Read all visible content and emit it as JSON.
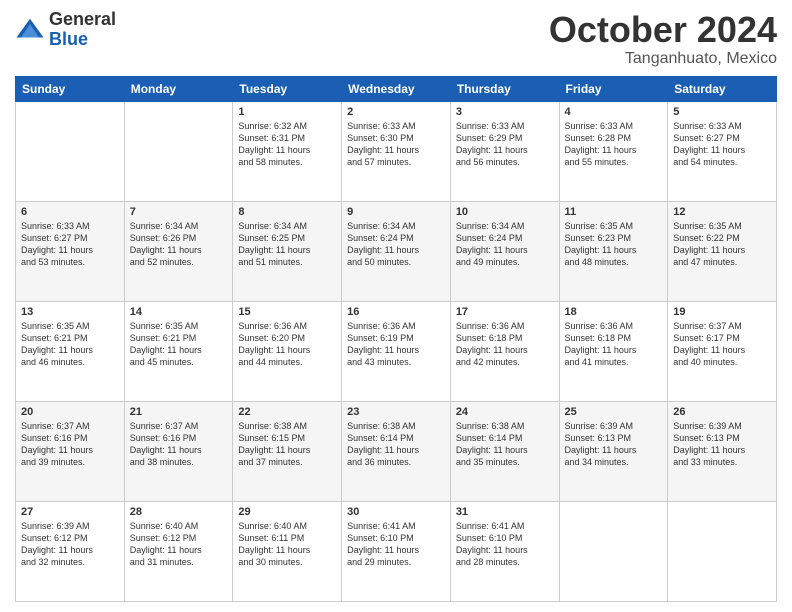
{
  "header": {
    "logo_general": "General",
    "logo_blue": "Blue",
    "month": "October 2024",
    "location": "Tanganhuato, Mexico"
  },
  "weekdays": [
    "Sunday",
    "Monday",
    "Tuesday",
    "Wednesday",
    "Thursday",
    "Friday",
    "Saturday"
  ],
  "weeks": [
    [
      {
        "day": "",
        "lines": []
      },
      {
        "day": "",
        "lines": []
      },
      {
        "day": "1",
        "lines": [
          "Sunrise: 6:32 AM",
          "Sunset: 6:31 PM",
          "Daylight: 11 hours",
          "and 58 minutes."
        ]
      },
      {
        "day": "2",
        "lines": [
          "Sunrise: 6:33 AM",
          "Sunset: 6:30 PM",
          "Daylight: 11 hours",
          "and 57 minutes."
        ]
      },
      {
        "day": "3",
        "lines": [
          "Sunrise: 6:33 AM",
          "Sunset: 6:29 PM",
          "Daylight: 11 hours",
          "and 56 minutes."
        ]
      },
      {
        "day": "4",
        "lines": [
          "Sunrise: 6:33 AM",
          "Sunset: 6:28 PM",
          "Daylight: 11 hours",
          "and 55 minutes."
        ]
      },
      {
        "day": "5",
        "lines": [
          "Sunrise: 6:33 AM",
          "Sunset: 6:27 PM",
          "Daylight: 11 hours",
          "and 54 minutes."
        ]
      }
    ],
    [
      {
        "day": "6",
        "lines": [
          "Sunrise: 6:33 AM",
          "Sunset: 6:27 PM",
          "Daylight: 11 hours",
          "and 53 minutes."
        ]
      },
      {
        "day": "7",
        "lines": [
          "Sunrise: 6:34 AM",
          "Sunset: 6:26 PM",
          "Daylight: 11 hours",
          "and 52 minutes."
        ]
      },
      {
        "day": "8",
        "lines": [
          "Sunrise: 6:34 AM",
          "Sunset: 6:25 PM",
          "Daylight: 11 hours",
          "and 51 minutes."
        ]
      },
      {
        "day": "9",
        "lines": [
          "Sunrise: 6:34 AM",
          "Sunset: 6:24 PM",
          "Daylight: 11 hours",
          "and 50 minutes."
        ]
      },
      {
        "day": "10",
        "lines": [
          "Sunrise: 6:34 AM",
          "Sunset: 6:24 PM",
          "Daylight: 11 hours",
          "and 49 minutes."
        ]
      },
      {
        "day": "11",
        "lines": [
          "Sunrise: 6:35 AM",
          "Sunset: 6:23 PM",
          "Daylight: 11 hours",
          "and 48 minutes."
        ]
      },
      {
        "day": "12",
        "lines": [
          "Sunrise: 6:35 AM",
          "Sunset: 6:22 PM",
          "Daylight: 11 hours",
          "and 47 minutes."
        ]
      }
    ],
    [
      {
        "day": "13",
        "lines": [
          "Sunrise: 6:35 AM",
          "Sunset: 6:21 PM",
          "Daylight: 11 hours",
          "and 46 minutes."
        ]
      },
      {
        "day": "14",
        "lines": [
          "Sunrise: 6:35 AM",
          "Sunset: 6:21 PM",
          "Daylight: 11 hours",
          "and 45 minutes."
        ]
      },
      {
        "day": "15",
        "lines": [
          "Sunrise: 6:36 AM",
          "Sunset: 6:20 PM",
          "Daylight: 11 hours",
          "and 44 minutes."
        ]
      },
      {
        "day": "16",
        "lines": [
          "Sunrise: 6:36 AM",
          "Sunset: 6:19 PM",
          "Daylight: 11 hours",
          "and 43 minutes."
        ]
      },
      {
        "day": "17",
        "lines": [
          "Sunrise: 6:36 AM",
          "Sunset: 6:18 PM",
          "Daylight: 11 hours",
          "and 42 minutes."
        ]
      },
      {
        "day": "18",
        "lines": [
          "Sunrise: 6:36 AM",
          "Sunset: 6:18 PM",
          "Daylight: 11 hours",
          "and 41 minutes."
        ]
      },
      {
        "day": "19",
        "lines": [
          "Sunrise: 6:37 AM",
          "Sunset: 6:17 PM",
          "Daylight: 11 hours",
          "and 40 minutes."
        ]
      }
    ],
    [
      {
        "day": "20",
        "lines": [
          "Sunrise: 6:37 AM",
          "Sunset: 6:16 PM",
          "Daylight: 11 hours",
          "and 39 minutes."
        ]
      },
      {
        "day": "21",
        "lines": [
          "Sunrise: 6:37 AM",
          "Sunset: 6:16 PM",
          "Daylight: 11 hours",
          "and 38 minutes."
        ]
      },
      {
        "day": "22",
        "lines": [
          "Sunrise: 6:38 AM",
          "Sunset: 6:15 PM",
          "Daylight: 11 hours",
          "and 37 minutes."
        ]
      },
      {
        "day": "23",
        "lines": [
          "Sunrise: 6:38 AM",
          "Sunset: 6:14 PM",
          "Daylight: 11 hours",
          "and 36 minutes."
        ]
      },
      {
        "day": "24",
        "lines": [
          "Sunrise: 6:38 AM",
          "Sunset: 6:14 PM",
          "Daylight: 11 hours",
          "and 35 minutes."
        ]
      },
      {
        "day": "25",
        "lines": [
          "Sunrise: 6:39 AM",
          "Sunset: 6:13 PM",
          "Daylight: 11 hours",
          "and 34 minutes."
        ]
      },
      {
        "day": "26",
        "lines": [
          "Sunrise: 6:39 AM",
          "Sunset: 6:13 PM",
          "Daylight: 11 hours",
          "and 33 minutes."
        ]
      }
    ],
    [
      {
        "day": "27",
        "lines": [
          "Sunrise: 6:39 AM",
          "Sunset: 6:12 PM",
          "Daylight: 11 hours",
          "and 32 minutes."
        ]
      },
      {
        "day": "28",
        "lines": [
          "Sunrise: 6:40 AM",
          "Sunset: 6:12 PM",
          "Daylight: 11 hours",
          "and 31 minutes."
        ]
      },
      {
        "day": "29",
        "lines": [
          "Sunrise: 6:40 AM",
          "Sunset: 6:11 PM",
          "Daylight: 11 hours",
          "and 30 minutes."
        ]
      },
      {
        "day": "30",
        "lines": [
          "Sunrise: 6:41 AM",
          "Sunset: 6:10 PM",
          "Daylight: 11 hours",
          "and 29 minutes."
        ]
      },
      {
        "day": "31",
        "lines": [
          "Sunrise: 6:41 AM",
          "Sunset: 6:10 PM",
          "Daylight: 11 hours",
          "and 28 minutes."
        ]
      },
      {
        "day": "",
        "lines": []
      },
      {
        "day": "",
        "lines": []
      }
    ]
  ]
}
